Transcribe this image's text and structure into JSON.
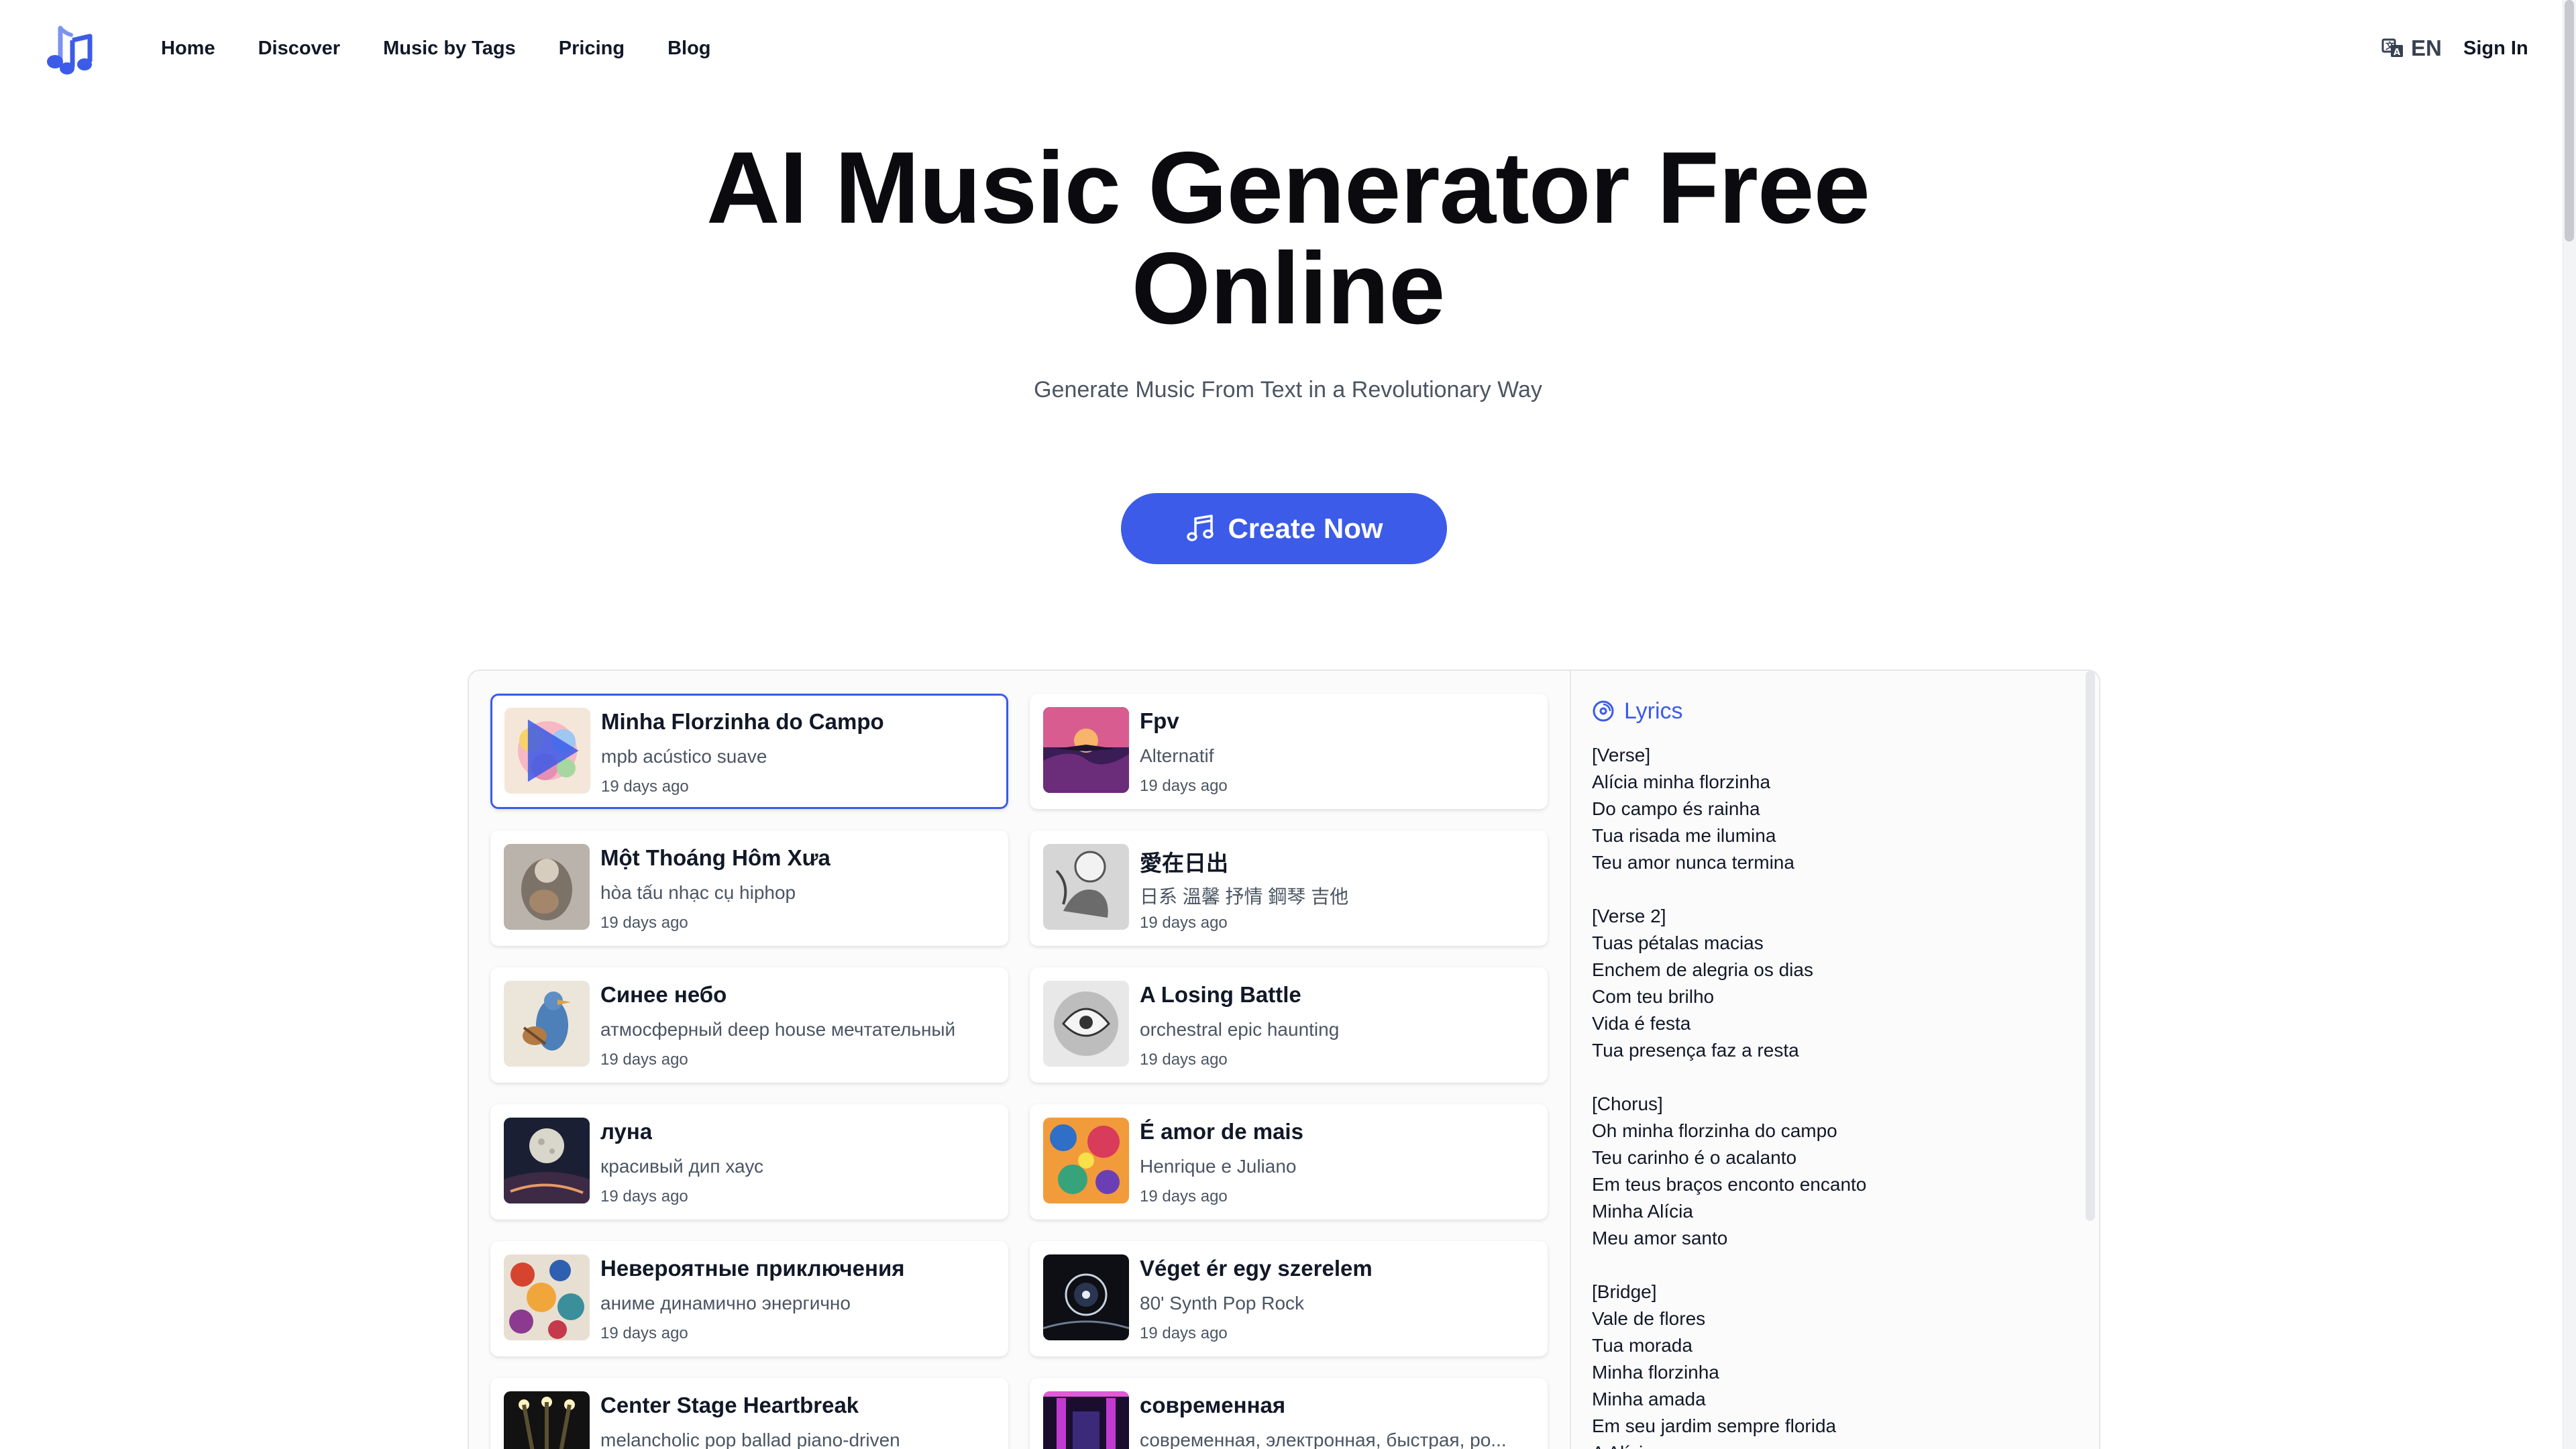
{
  "header": {
    "nav": [
      "Home",
      "Discover",
      "Music by Tags",
      "Pricing",
      "Blog"
    ],
    "language": "EN",
    "signin": "Sign In"
  },
  "hero": {
    "title_line1": "AI Music Generator Free",
    "title_line2": "Online",
    "subtitle": "Generate Music From Text in a Revolutionary Way",
    "cta": "Create Now"
  },
  "songs": [
    {
      "title": "Minha Florzinha do Campo",
      "tags": "mpb acústico suave",
      "date": "19 days ago"
    },
    {
      "title": "Fpv",
      "tags": "Alternatif",
      "date": "19 days ago"
    },
    {
      "title": "Một Thoáng Hôm Xưa",
      "tags": "hòa tấu nhạc cụ hiphop",
      "date": "19 days ago"
    },
    {
      "title": "愛在日出",
      "tags": "日系 溫馨 抒情 鋼琴 吉他",
      "date": "19 days ago"
    },
    {
      "title": "Синее небо",
      "tags": "атмосферный deep house мечтательный",
      "date": "19 days ago"
    },
    {
      "title": "A Losing Battle",
      "tags": "orchestral epic haunting",
      "date": "19 days ago"
    },
    {
      "title": "луна",
      "tags": "красивый дип хаус",
      "date": "19 days ago"
    },
    {
      "title": "É amor de mais",
      "tags": "Henrique e Juliano",
      "date": "19 days ago"
    },
    {
      "title": "Невероятные приключения",
      "tags": "аниме динамично энергично",
      "date": "19 days ago"
    },
    {
      "title": "Véget ér egy szerelem",
      "tags": "80' Synth Pop Rock",
      "date": "19 days ago"
    },
    {
      "title": "Center Stage Heartbreak",
      "tags": "melancholic pop ballad piano-driven",
      "date": ""
    },
    {
      "title": "современная",
      "tags": "современная, электронная, быстрая, ро...",
      "date": ""
    }
  ],
  "lyrics": {
    "heading": "Lyrics",
    "lines": [
      "[Verse]",
      "Alícia minha florzinha",
      "Do campo és rainha",
      "Tua risada me ilumina",
      "Teu amor nunca termina",
      "",
      "[Verse 2]",
      "Tuas pétalas macias",
      "Enchem de alegria os dias",
      "Com teu brilho",
      "Vida é festa",
      "Tua presença faz a resta",
      "",
      "[Chorus]",
      "Oh minha florzinha do campo",
      "Teu carinho é o acalanto",
      "Em teus braços enconto encanto",
      "Minha Alícia",
      "Meu amor santo",
      "",
      "[Bridge]",
      "Vale de flores",
      "Tua morada",
      "Minha florzinha",
      "Minha amada",
      "Em seu jardim sempre florida",
      "A Alícia"
    ]
  },
  "colors": {
    "accent": "#3b5be8",
    "text": "#111827",
    "muted": "#4b5563"
  },
  "icons": {
    "logo": "music-note-logo-icon",
    "language": "translate-icon",
    "cta": "music-note-icon",
    "lyrics": "disc-icon",
    "play": "play-icon"
  }
}
